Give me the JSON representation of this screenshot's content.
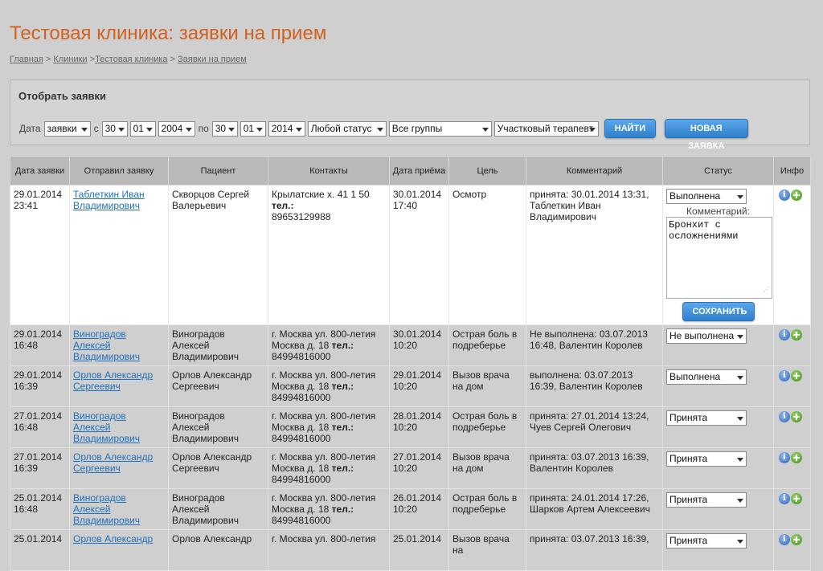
{
  "page": {
    "title": "Тестовая клиника: заявки на прием"
  },
  "breadcrumb": {
    "home": "Главная",
    "sep1": " > ",
    "clinics": "Клиники",
    "sep2": " >",
    "clinic": "Тестовая клиника",
    "sep3": " > ",
    "current": "Заявки на прием"
  },
  "filter": {
    "title": "Отобрать заявки",
    "date_label": "Дата",
    "date_type": "заявки",
    "from_label": "с",
    "from_day": "30",
    "from_month": "01",
    "from_year": "2004",
    "to_label": "по",
    "to_day": "30",
    "to_month": "01",
    "to_year": "2014",
    "status": "Любой статус",
    "group": "Все группы",
    "doctor": "Участковый терапевт",
    "find_button": "НАЙТИ",
    "new_button": "НОВАЯ ЗАЯВКА"
  },
  "table": {
    "headers": [
      "Дата заявки",
      "Отправил заявку",
      "Пациент",
      "Контакты",
      "Дата приёма",
      "Цель",
      "Комментарий",
      "Статус",
      "Инфо"
    ],
    "active_row": {
      "date": "29.01.2014",
      "time": "23:41",
      "sender": "Таблеткин Иван Владимирович",
      "patient": "Скворцов Сергей Валерьевич",
      "contacts": "Крылатские х. 41 1 50",
      "phone_label": "тел.:",
      "phone": "89653129988",
      "visit_date": "30.01.2014",
      "visit_time": "17:40",
      "goal": "Осмотр",
      "comment": "принята: 30.01.2014 13:31, Таблеткин Иван Владимирович",
      "status": "Выполнена",
      "comment_label": "Комментарий:",
      "comment_text": "Бронхит с осложнениями",
      "save_button": "СОХРАНИТЬ"
    },
    "rows": [
      {
        "date": "29.01.2014",
        "time": "16:48",
        "sender": "Виноградов Алексей Владимирович",
        "patient": "Виноградов Алексей Владимирович",
        "contacts": "г. Москва ул. 800-летия Москва д. 18",
        "phone_label": "тел.:",
        "phone": "84994816000",
        "visit_date": "30.01.2014",
        "visit_time": "10:20",
        "goal": "Острая боль в подреберье",
        "comment": "Не выполнена: 03.07.2013 16:48, Валентин Королев",
        "status": "Не выполнена"
      },
      {
        "date": "29.01.2014",
        "time": "16:39",
        "sender": "Орлов Александр Сергеевич",
        "patient": "Орлов Александр Сергеевич",
        "contacts": "г. Москва ул. 800-летия Москва д. 18",
        "phone_label": "тел.:",
        "phone": "84994816000",
        "visit_date": "29.01.2014",
        "visit_time": "10:20",
        "goal": "Вызов врача на дом",
        "comment": "выполнена: 03.07.2013 16:39, Валентин Королев",
        "status": "Выполнена"
      },
      {
        "date": "27.01.2014",
        "time": "16:48",
        "sender": "Виноградов Алексей Владимирович",
        "patient": "Виноградов Алексей Владимирович",
        "contacts": "г. Москва ул. 800-летия Москва д. 18",
        "phone_label": "тел.:",
        "phone": "84994816000",
        "visit_date": "28.01.2014",
        "visit_time": "10:20",
        "goal": "Острая боль в подреберье",
        "comment": "принята: 27.01.2014 13:24, Чуев Сергей Олегович",
        "status": "Принята"
      },
      {
        "date": "27.01.2014",
        "time": "16:39",
        "sender": "Орлов Александр Сергеевич",
        "patient": "Орлов Александр Сергеевич",
        "contacts": "г. Москва ул. 800-летия Москва д. 18",
        "phone_label": "тел.:",
        "phone": "84994816000",
        "visit_date": "27.01.2014",
        "visit_time": "10:20",
        "goal": "Вызов врача на дом",
        "comment": "принята: 03.07.2013 16:39, Валентин Королев",
        "status": "Принята"
      },
      {
        "date": "25.01.2014",
        "time": "16:48",
        "sender": "Виноградов Алексей Владимирович",
        "patient": "Виноградов Алексей Владимирович",
        "contacts": "г. Москва ул. 800-летия Москва д. 18",
        "phone_label": "тел.:",
        "phone": "84994816000",
        "visit_date": "26.01.2014",
        "visit_time": "10:20",
        "goal": "Острая боль в подреберье",
        "comment": "принята: 24.01.2014 17:26, Шарков Артем Алексеевич",
        "status": "Принята"
      },
      {
        "date": "25.01.2014",
        "time": "",
        "sender": "Орлов Александр",
        "patient": "Орлов Александр",
        "contacts": "г. Москва ул. 800-летия",
        "phone_label": "",
        "phone": "",
        "visit_date": "25.01.2014",
        "visit_time": "",
        "goal": "Вызов врача на",
        "comment": "принята: 03.07.2013 16:39,",
        "status": "Принята"
      }
    ]
  }
}
